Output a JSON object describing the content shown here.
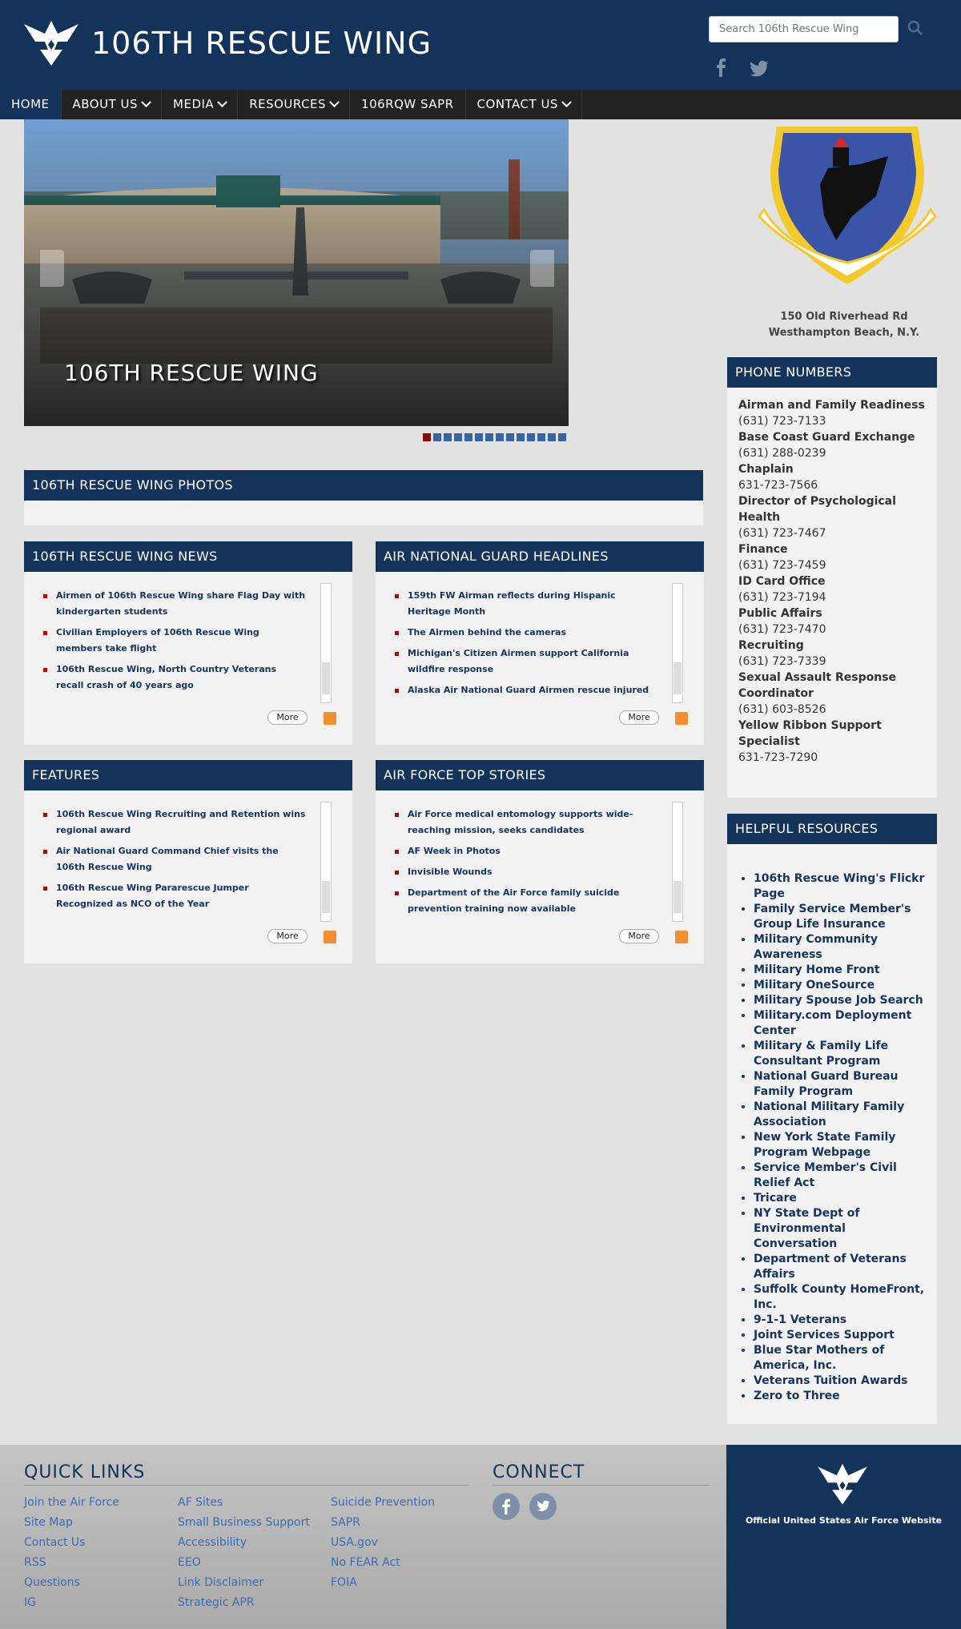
{
  "header": {
    "site_title": "106TH RESCUE WING",
    "search_placeholder": "Search 106th Rescue Wing"
  },
  "nav": [
    {
      "label": "HOME"
    },
    {
      "label": "ABOUT US"
    },
    {
      "label": "MEDIA"
    },
    {
      "label": "RESOURCES"
    },
    {
      "label": "106RQW SAPR"
    },
    {
      "label": "CONTACT US"
    }
  ],
  "slider": {
    "caption": "106TH RESCUE WING",
    "dot_count": 14,
    "active_dot": 0
  },
  "photos": {
    "title": "106TH RESCUE WING PHOTOS"
  },
  "news": {
    "title": "106TH RESCUE WING NEWS",
    "items": [
      "Airmen of 106th Rescue Wing share Flag Day with kindergarten students",
      "Civilian Employers of 106th Rescue Wing members take flight",
      "106th Rescue Wing, North Country Veterans recall crash of 40 years ago"
    ],
    "more": "More"
  },
  "ang": {
    "title": "AIR NATIONAL GUARD HEADLINES",
    "items": [
      "159th FW Airman reflects during Hispanic Heritage Month",
      "The Airmen behind the cameras",
      "Michigan's Citizen Airmen support California wildfire response",
      "Alaska Air National Guard Airmen rescue injured"
    ],
    "more": "More"
  },
  "features": {
    "title": "FEATURES",
    "items": [
      "106th Rescue Wing Recruiting and Retention wins regional award",
      "Air National Guard Command Chief visits the 106th Rescue Wing",
      "106th Rescue Wing Pararescue Jumper Recognized as NCO of the Year"
    ],
    "more": "More"
  },
  "af_top": {
    "title": "AIR FORCE TOP STORIES",
    "items": [
      "Air Force medical entomology supports wide-reaching mission, seeks candidates",
      "AF Week in Photos",
      "Invisible Wounds",
      "Department of the Air Force family suicide prevention training now available"
    ],
    "more": "More"
  },
  "address": {
    "line1": "150 Old Riverhead Rd",
    "line2": "Westhampton Beach, N.Y."
  },
  "phones": {
    "title": "PHONE NUMBERS",
    "entries": [
      {
        "name": "Airman and Family Readiness",
        "number": "(631) 723-7133"
      },
      {
        "name": "Base Coast Guard Exchange",
        "number": "(631) 288-0239"
      },
      {
        "name": "Chaplain",
        "number": "631-723-7566"
      },
      {
        "name": "Director of Psychological Health",
        "number": "(631) 723-7467"
      },
      {
        "name": "Finance",
        "number": "(631) 723-7459"
      },
      {
        "name": "ID Card Office",
        "number": "(631) 723-7194"
      },
      {
        "name": "Public Affairs",
        "number": "(631) 723-7470"
      },
      {
        "name": "Recruiting",
        "number": "(631) 723-7339"
      },
      {
        "name": "Sexual Assault Response Coordinator",
        "number": "(631) 603-8526"
      },
      {
        "name": "Yellow Ribbon Support Specialist",
        "number": "631-723-7290"
      }
    ]
  },
  "resources": {
    "title": "HELPFUL RESOURCES",
    "items": [
      "106th Rescue Wing's Flickr Page",
      "Family Service Member's Group Life Insurance",
      "Military Community Awareness",
      "Military Home Front",
      "Military OneSource",
      "Military Spouse Job Search",
      "Military.com Deployment Center",
      "Military & Family Life Consultant Program",
      "National Guard Bureau Family Program",
      "National Military Family Association",
      "New York State Family Program Webpage",
      "Service Member's Civil Relief Act",
      "Tricare",
      "NY State Dept of Environmental Conversation",
      "Department of Veterans Affairs",
      "Suffolk County HomeFront, Inc.",
      "9-1-1 Veterans",
      "Joint Services Support",
      "Blue Star Mothers of America, Inc.",
      "Veterans Tuition Awards",
      "Zero to Three"
    ]
  },
  "footer": {
    "quick_links_title": "QUICK LINKS",
    "connect_title": "CONNECT",
    "col1": [
      "Join the Air Force",
      "Site Map",
      "Contact Us",
      "RSS",
      "Questions",
      "IG"
    ],
    "col2": [
      "AF Sites",
      "Small Business Support",
      "Accessibility",
      "EEO",
      "Link Disclaimer",
      "Strategic APR"
    ],
    "col3": [
      "Suicide Prevention",
      "SAPR",
      "USA.gov",
      "No FEAR Act",
      "FOIA"
    ],
    "official": "Official United States Air Force Website"
  },
  "colors": {
    "navy": "#13335a",
    "nav_bar": "#222222",
    "accent_red": "#8b0c0c",
    "link_blue": "#3a6ab3"
  }
}
